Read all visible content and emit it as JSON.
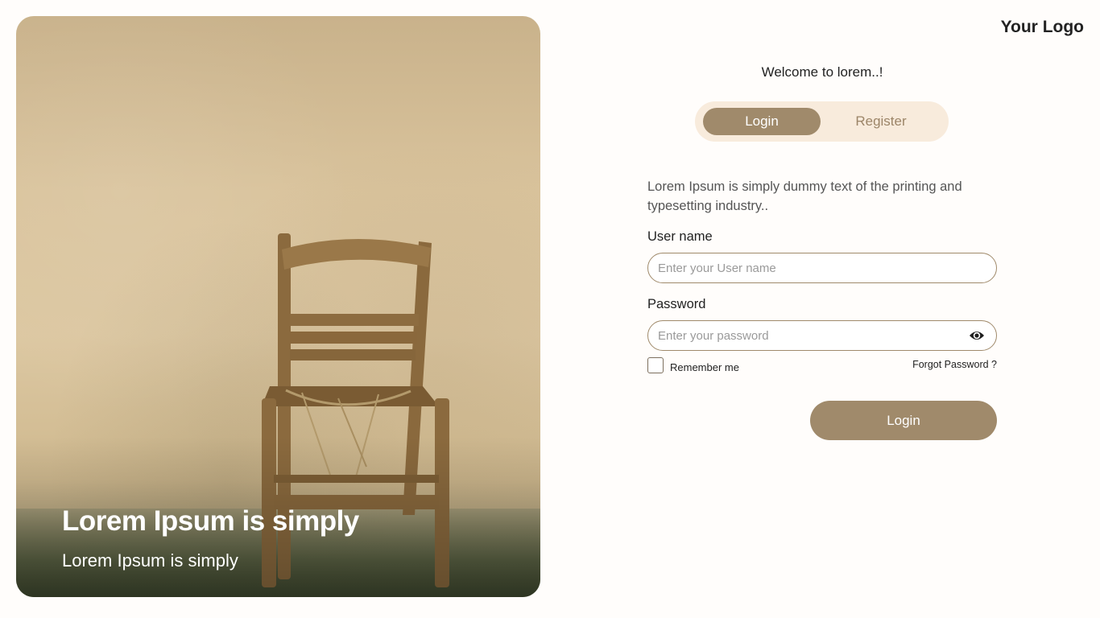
{
  "hero": {
    "title": "Lorem Ipsum is simply",
    "subtitle": "Lorem Ipsum is simply"
  },
  "header": {
    "logo": "Your Logo"
  },
  "auth": {
    "welcome": "Welcome to lorem..!",
    "tabs": [
      {
        "label": "Login",
        "active": true
      },
      {
        "label": "Register",
        "active": false
      }
    ],
    "intro": "Lorem Ipsum is simply dummy text of the printing and typesetting industry..",
    "username": {
      "label": "User name",
      "placeholder": "Enter your User name",
      "value": ""
    },
    "password": {
      "label": "Password",
      "placeholder": "Enter your password",
      "value": "",
      "toggle_icon": "eye-icon"
    },
    "remember_label": "Remember me",
    "remember_checked": false,
    "forgot_label": "Forgot Password ?",
    "submit_label": "Login"
  },
  "colors": {
    "accent": "#a08a6b",
    "tab_track": "#f8ebdc",
    "inactive_tab_text": "#9c8568"
  }
}
